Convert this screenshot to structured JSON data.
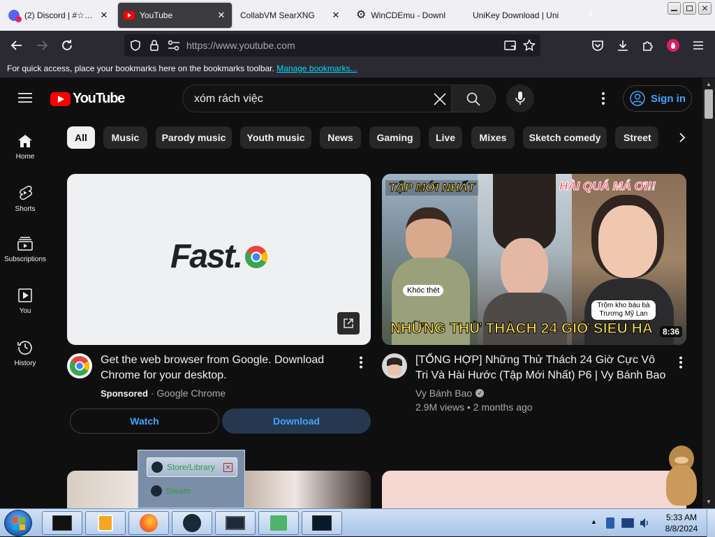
{
  "browser": {
    "tabs": [
      {
        "title": "(2) Discord | #☆ | b",
        "icon": "discord-icon",
        "active": false
      },
      {
        "title": "YouTube",
        "icon": "youtube-icon",
        "active": true
      },
      {
        "title": "CollabVM SearXNG",
        "icon": "",
        "active": false
      },
      {
        "title": "WinCDEmu - Downl",
        "icon": "gear-icon",
        "active": false
      },
      {
        "title": "UniKey Download | Uni",
        "icon": "",
        "active": false
      }
    ],
    "url": "https://www.youtube.com",
    "bookmarks_text": "For quick access, place your bookmarks here on the bookmarks toolbar.",
    "bookmarks_link": "Manage bookmarks..."
  },
  "youtube": {
    "logo_text": "YouTube",
    "search_value": "xóm rách việc",
    "sign_in": "Sign in",
    "chips": [
      "All",
      "Music",
      "Parody music",
      "Youth music",
      "News",
      "Gaming",
      "Live",
      "Mixes",
      "Sketch comedy",
      "Street"
    ],
    "sidebar": [
      {
        "label": "Home",
        "icon": "home-icon"
      },
      {
        "label": "Shorts",
        "icon": "shorts-icon"
      },
      {
        "label": "Subscriptions",
        "icon": "subscriptions-icon"
      },
      {
        "label": "You",
        "icon": "you-icon"
      },
      {
        "label": "History",
        "icon": "history-icon"
      }
    ],
    "ad": {
      "thumb_text": "Fast.",
      "title": "Get the web browser from Google. Download Chrome for your desktop.",
      "sponsored": "Sponsored",
      "sponsor_name": "Google Chrome",
      "watch": "Watch",
      "download": "Download"
    },
    "video": {
      "title": "[TỔNG HỢP] Những Thử Thách 24 Giờ Cực Vô Tri Và Hài Hước (Tập Mới Nhất) P6 | Vy Bánh Bao",
      "channel": "Vy Bánh Bao",
      "views": "2.9M views",
      "age": "2 months ago",
      "duration": "8:36",
      "thumb_tag_left": "TẬP MỚI NHẤT",
      "thumb_tag_right": "HÀI QUÁ MÁ ƠI!!",
      "thumb_caption": "NHỮNG THỬ THÁCH 24 GIỜ SIÊU HÀ",
      "bubble_1": "Khóc thét",
      "bubble_2": "Trộm kho báu bà Trương Mỹ Lan"
    }
  },
  "taskbar": {
    "time": "5:33 AM",
    "date": "8/8/2024"
  },
  "steam_popup": {
    "item_1": "Store/Library",
    "item_2": "Steam"
  }
}
